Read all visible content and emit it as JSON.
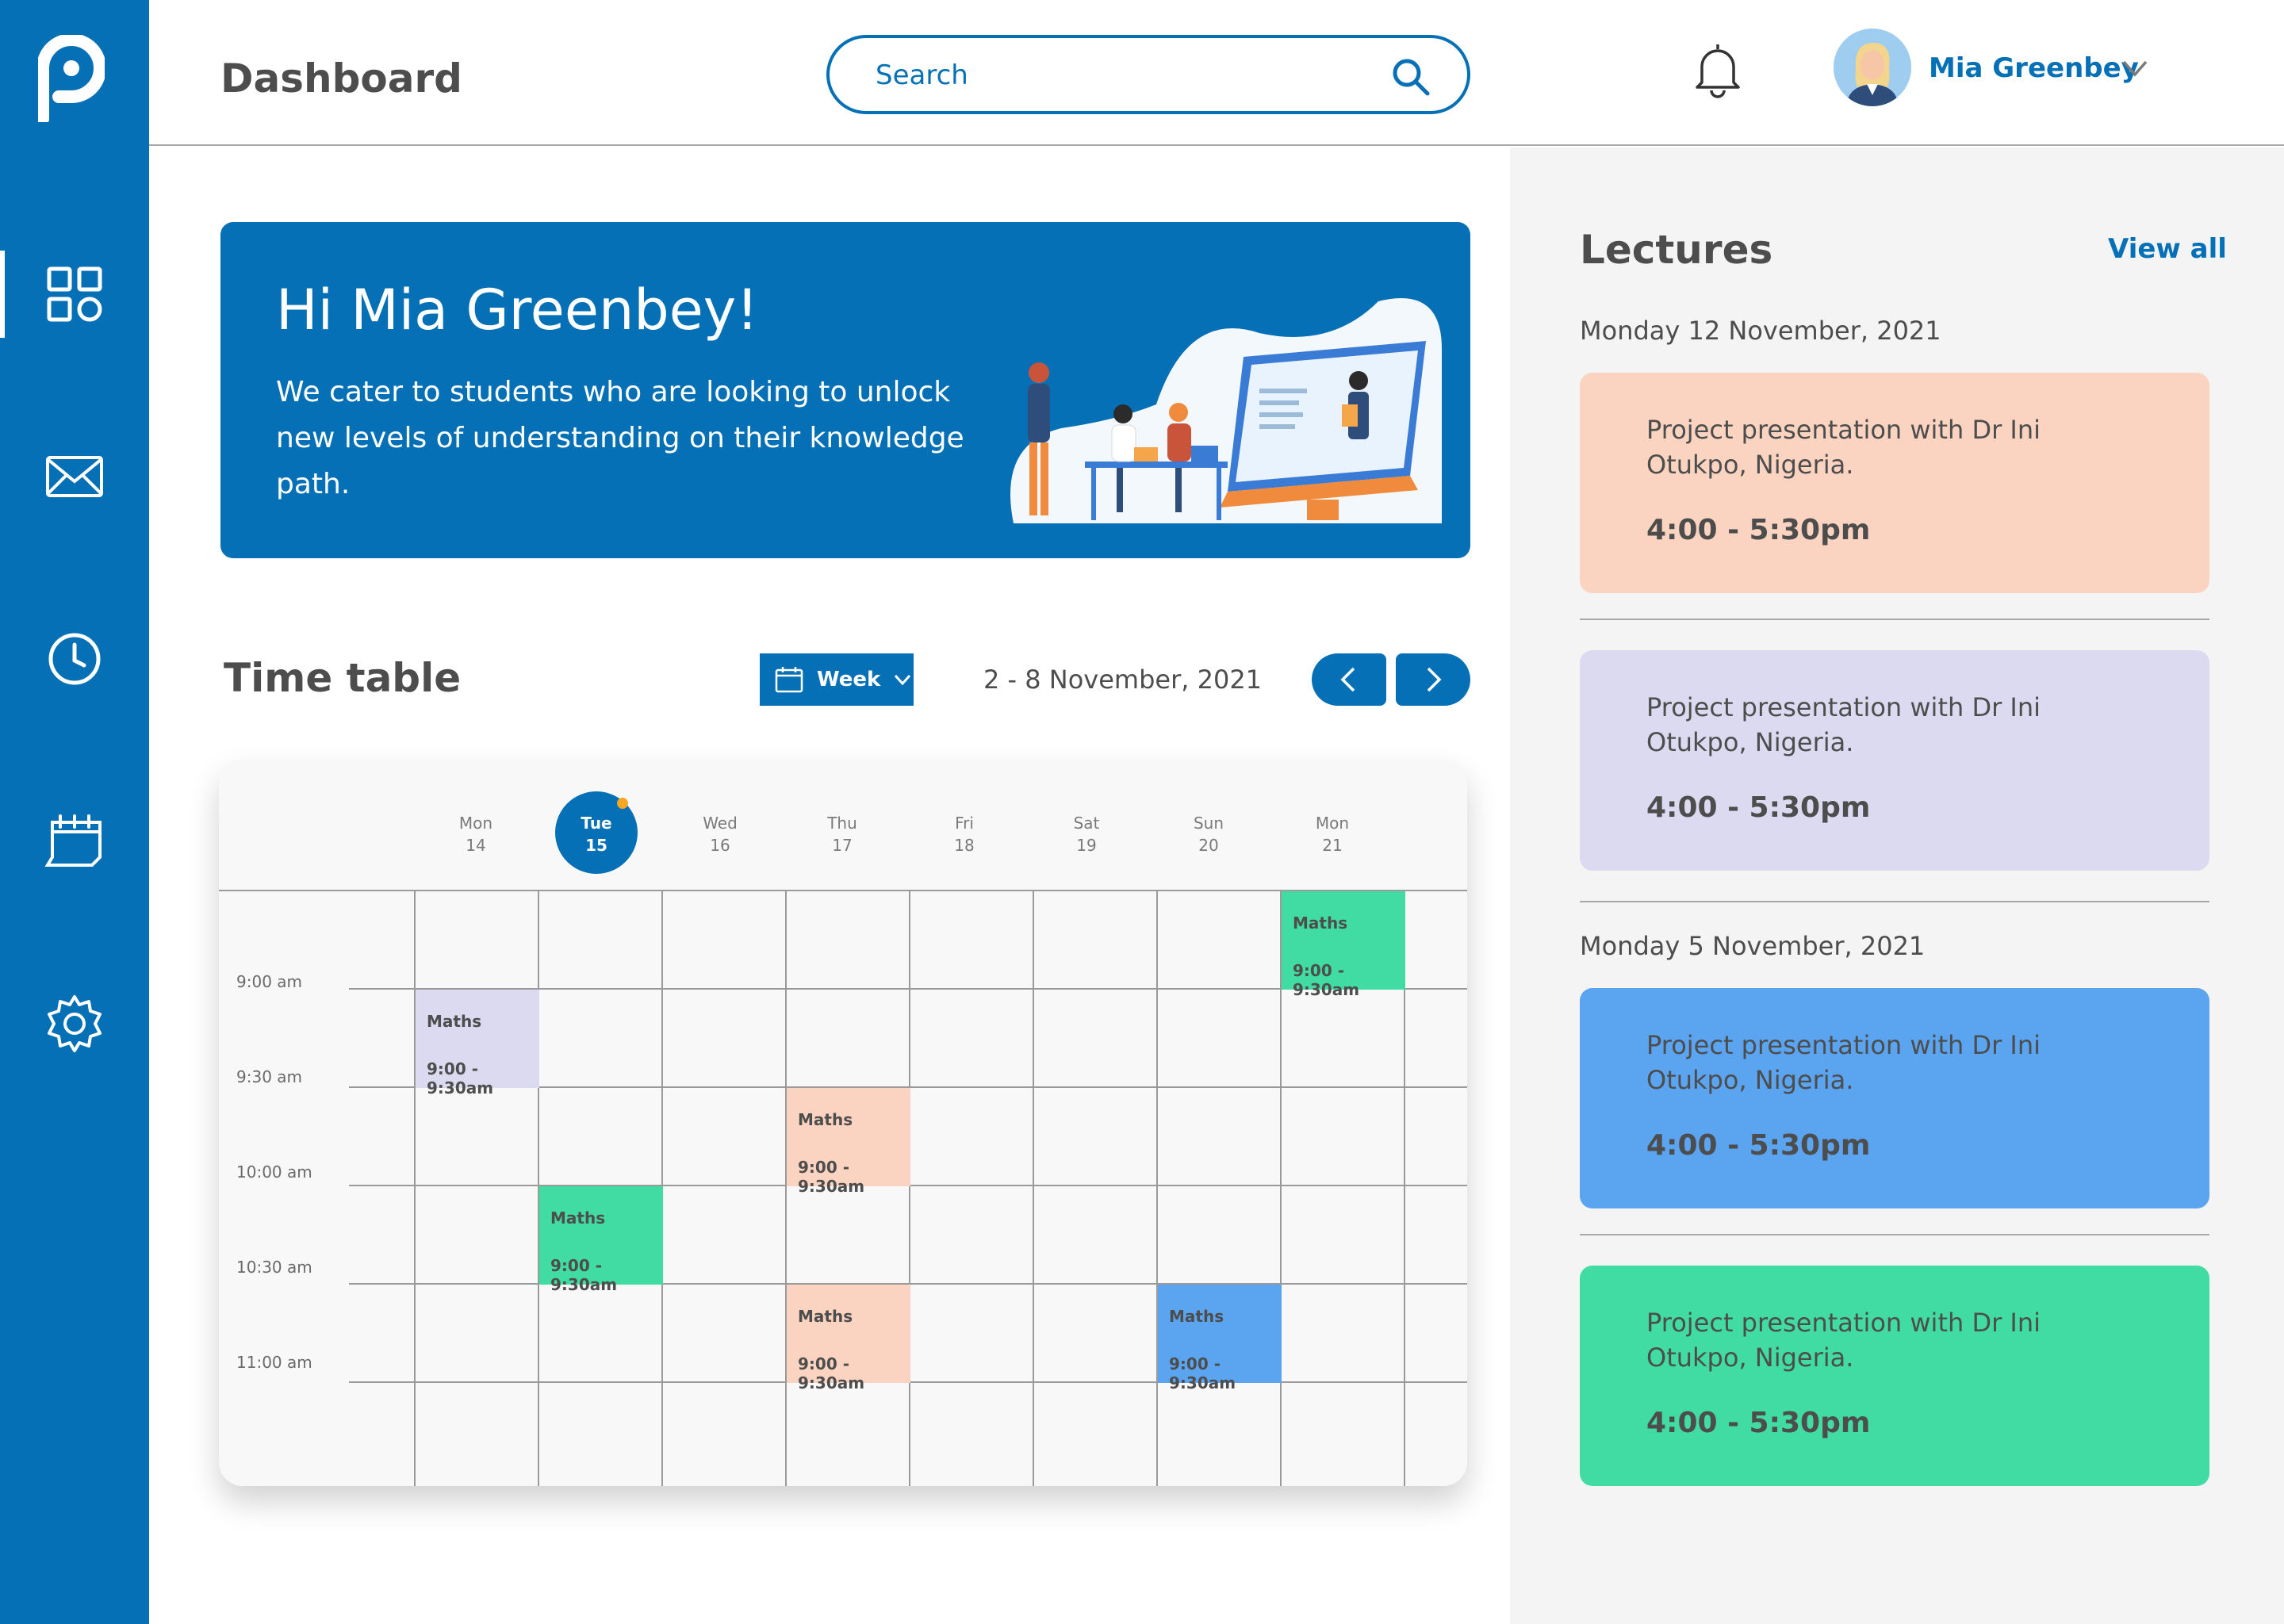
{
  "app": {
    "page_title": "Dashboard",
    "icons": [
      "logo-icon",
      "dashboard-icon",
      "mail-icon",
      "clock-icon",
      "calendar-icon",
      "settings-icon",
      "search-icon",
      "bell-icon",
      "chevron-down-icon"
    ]
  },
  "header": {
    "search_placeholder": "Search",
    "user_name": "Mia Greenbey"
  },
  "hero": {
    "greeting": "Hi Mia Greenbey!",
    "text": "We cater to students who are looking to unlock new levels of understanding on their knowledge path."
  },
  "timetable": {
    "title": "Time table",
    "view_label": "Week",
    "range": "2 - 8 November, 2021",
    "days": [
      {
        "name": "Mon",
        "num": "14"
      },
      {
        "name": "Tue",
        "num": "15"
      },
      {
        "name": "Wed",
        "num": "16"
      },
      {
        "name": "Thu",
        "num": "17"
      },
      {
        "name": "Fri",
        "num": "18"
      },
      {
        "name": "Sat",
        "num": "19"
      },
      {
        "name": "Sun",
        "num": "20"
      },
      {
        "name": "Mon",
        "num": "21"
      }
    ],
    "times": [
      "9:00 am",
      "9:30 am",
      "10:00 am",
      "10:30 am",
      "11:00 am"
    ],
    "events": [
      {
        "name": "Maths",
        "time": "9:00 - 9:30am",
        "color": "#40dca3"
      },
      {
        "name": "Maths",
        "time": "9:00 - 9:30am",
        "color": "#dcdaf0"
      },
      {
        "name": "Maths",
        "time": "9:00 - 9:30am",
        "color": "#fad4c0"
      },
      {
        "name": "Maths",
        "time": "9:00 - 9:30am",
        "color": "#40dca3"
      },
      {
        "name": "Maths",
        "time": "9:00 - 9:30am",
        "color": "#fad4c0"
      },
      {
        "name": "Maths",
        "time": "9:00 - 9:30am",
        "color": "#5aa4f0"
      }
    ]
  },
  "lectures": {
    "title": "Lectures",
    "view_all": "View all",
    "groups": [
      {
        "date": "Monday 12 November, 2021",
        "items": [
          {
            "title": "Project presentation with Dr Ini Otukpo, Nigeria.",
            "time": "4:00 - 5:30pm",
            "color": "#fad4c0"
          },
          {
            "title": "Project presentation with Dr Ini Otukpo, Nigeria.",
            "time": "4:00 - 5:30pm",
            "color": "#dcdaf0"
          }
        ]
      },
      {
        "date": "Monday 5 November, 2021",
        "items": [
          {
            "title": "Project presentation with Dr Ini Otukpo, Nigeria.",
            "time": "4:00 - 5:30pm",
            "color": "#5aa4f0"
          },
          {
            "title": "Project presentation with Dr Ini Otukpo, Nigeria.",
            "time": "4:00 - 5:30pm",
            "color": "#40dca3"
          }
        ]
      }
    ]
  },
  "colors": {
    "primary": "#0670b6",
    "accent_dot": "#f5a623"
  }
}
